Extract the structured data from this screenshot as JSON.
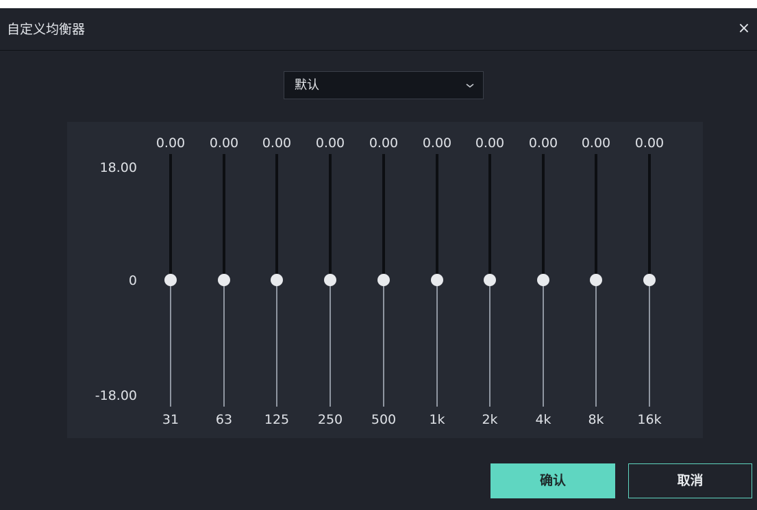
{
  "dialog": {
    "title": "自定义均衡器",
    "close_glyph": "×"
  },
  "preset": {
    "value": "默认",
    "icon": "chevron-down-icon"
  },
  "scale": {
    "max": "18.00",
    "mid": "0",
    "min": "-18.00"
  },
  "bands": [
    {
      "freq": "31",
      "gain": "0.00"
    },
    {
      "freq": "63",
      "gain": "0.00"
    },
    {
      "freq": "125",
      "gain": "0.00"
    },
    {
      "freq": "250",
      "gain": "0.00"
    },
    {
      "freq": "500",
      "gain": "0.00"
    },
    {
      "freq": "1k",
      "gain": "0.00"
    },
    {
      "freq": "2k",
      "gain": "0.00"
    },
    {
      "freq": "4k",
      "gain": "0.00"
    },
    {
      "freq": "8k",
      "gain": "0.00"
    },
    {
      "freq": "16k",
      "gain": "0.00"
    }
  ],
  "buttons": {
    "confirm": "确认",
    "cancel": "取消"
  },
  "colors": {
    "accent": "#5fd6c1",
    "background": "#20232b",
    "panel": "#262a33"
  }
}
